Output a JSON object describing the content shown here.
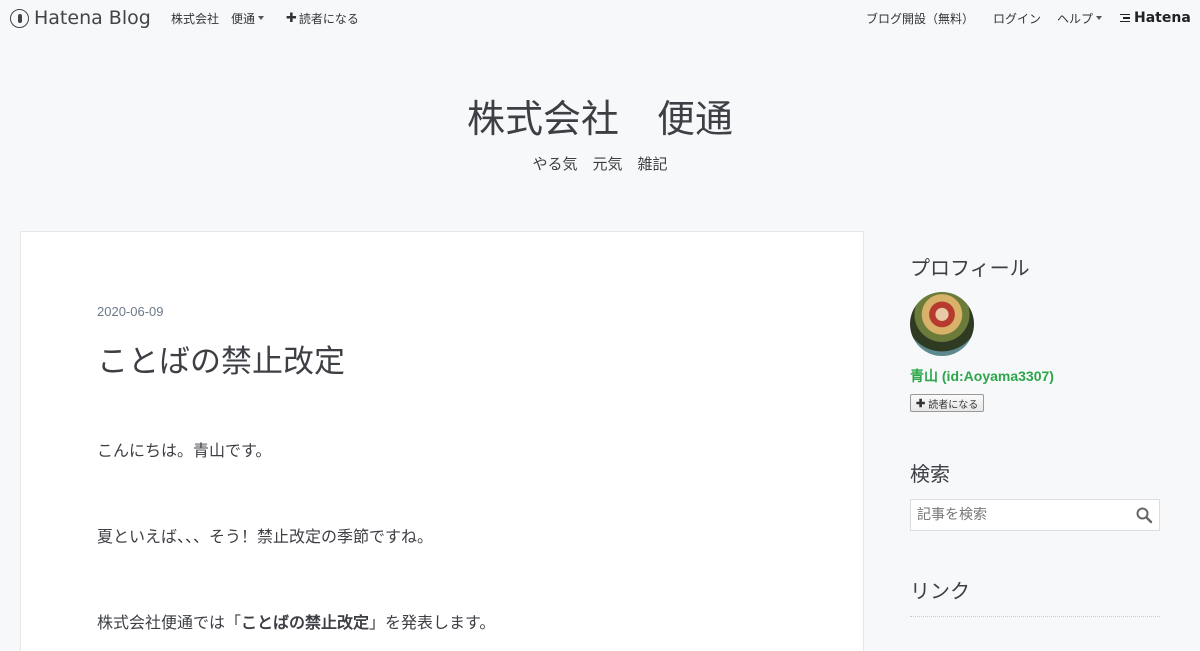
{
  "topbar": {
    "logo_text": "Hatena Blog",
    "blog_name": "株式会社　便通",
    "subscribe": "読者になる",
    "open_blog": "ブログ開設（無料）",
    "login": "ログイン",
    "help": "ヘルプ",
    "hatena": "Hatena"
  },
  "blog": {
    "title": "株式会社　便通",
    "description": "やる気　元気　雑記"
  },
  "entry": {
    "date": "2020-06-09",
    "title": "ことばの禁止改定",
    "p1": "こんにちは。青山です。",
    "p2": "夏といえば、、、そう！禁止改定の季節ですね。",
    "p3_before": "株式会社便通では「",
    "p3_bold": "ことばの禁止改定",
    "p3_after": "」を発表します。"
  },
  "sidebar": {
    "profile_heading": "プロフィール",
    "profile_name": "青山 (id:Aoyama3307)",
    "subscribe": "読者になる",
    "search_heading": "検索",
    "search_placeholder": "記事を検索",
    "links_heading": "リンク"
  },
  "colors": {
    "background": "#f7f8fa",
    "text": "#3d3f44",
    "profile_link": "#2ca64a",
    "date": "#6b7a8a"
  }
}
